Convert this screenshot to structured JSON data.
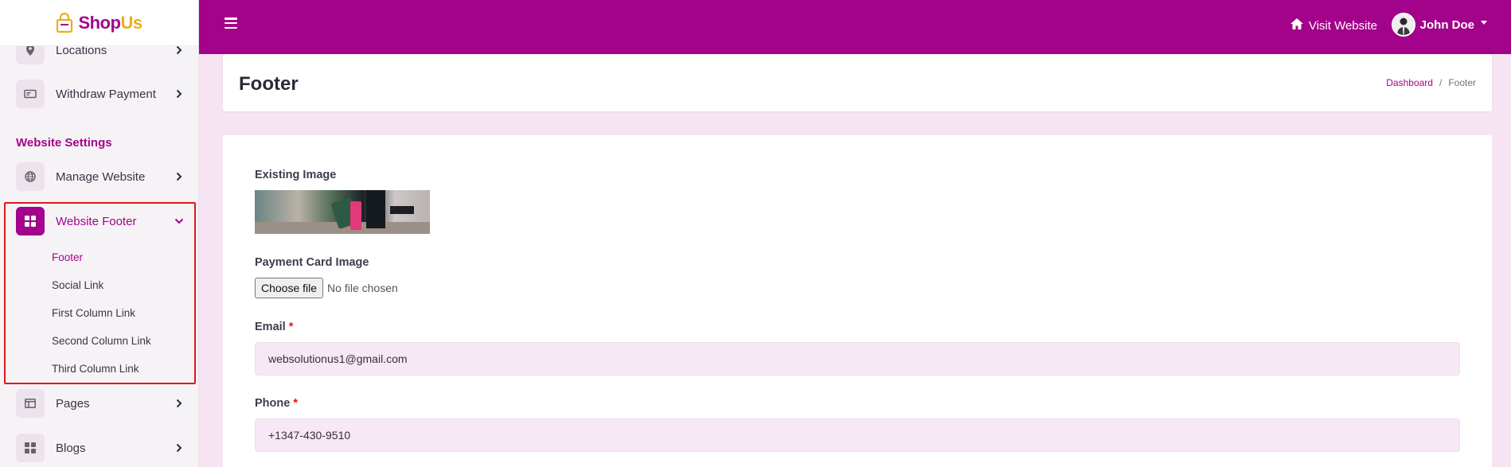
{
  "brand": {
    "name_part1": "Shop",
    "name_part2": "Us"
  },
  "sidebar": {
    "items_top": [
      {
        "label": "Locations",
        "icon": "map-pin-icon"
      },
      {
        "label": "Withdraw Payment",
        "icon": "money-icon"
      }
    ],
    "section_title": "Website Settings",
    "manage_website": {
      "label": "Manage Website",
      "icon": "globe-icon"
    },
    "website_footer": {
      "label": "Website Footer",
      "icon": "grid-icon",
      "subitems": [
        "Footer",
        "Social Link",
        "First Column Link",
        "Second Column Link",
        "Third Column Link"
      ]
    },
    "items_bottom": [
      {
        "label": "Pages",
        "icon": "layout-icon"
      },
      {
        "label": "Blogs",
        "icon": "grid-icon"
      }
    ]
  },
  "topbar": {
    "visit_label": "Visit Website",
    "user_name": "John Doe"
  },
  "header": {
    "title": "Footer",
    "breadcrumb": [
      "Dashboard",
      "Footer"
    ],
    "breadcrumb_sep": "/"
  },
  "form": {
    "existing_image_label": "Existing Image",
    "payment_card_label": "Payment Card Image",
    "file_button": "Choose file",
    "file_status": "No file chosen",
    "email_label": "Email",
    "email_value": "websolutionus1@gmail.com",
    "phone_label": "Phone",
    "phone_value": "+1347-430-9510",
    "required_mark": "*"
  },
  "colors": {
    "brand": "#a2048d",
    "accent": "#e8b019",
    "highlight": "#e0161b"
  }
}
